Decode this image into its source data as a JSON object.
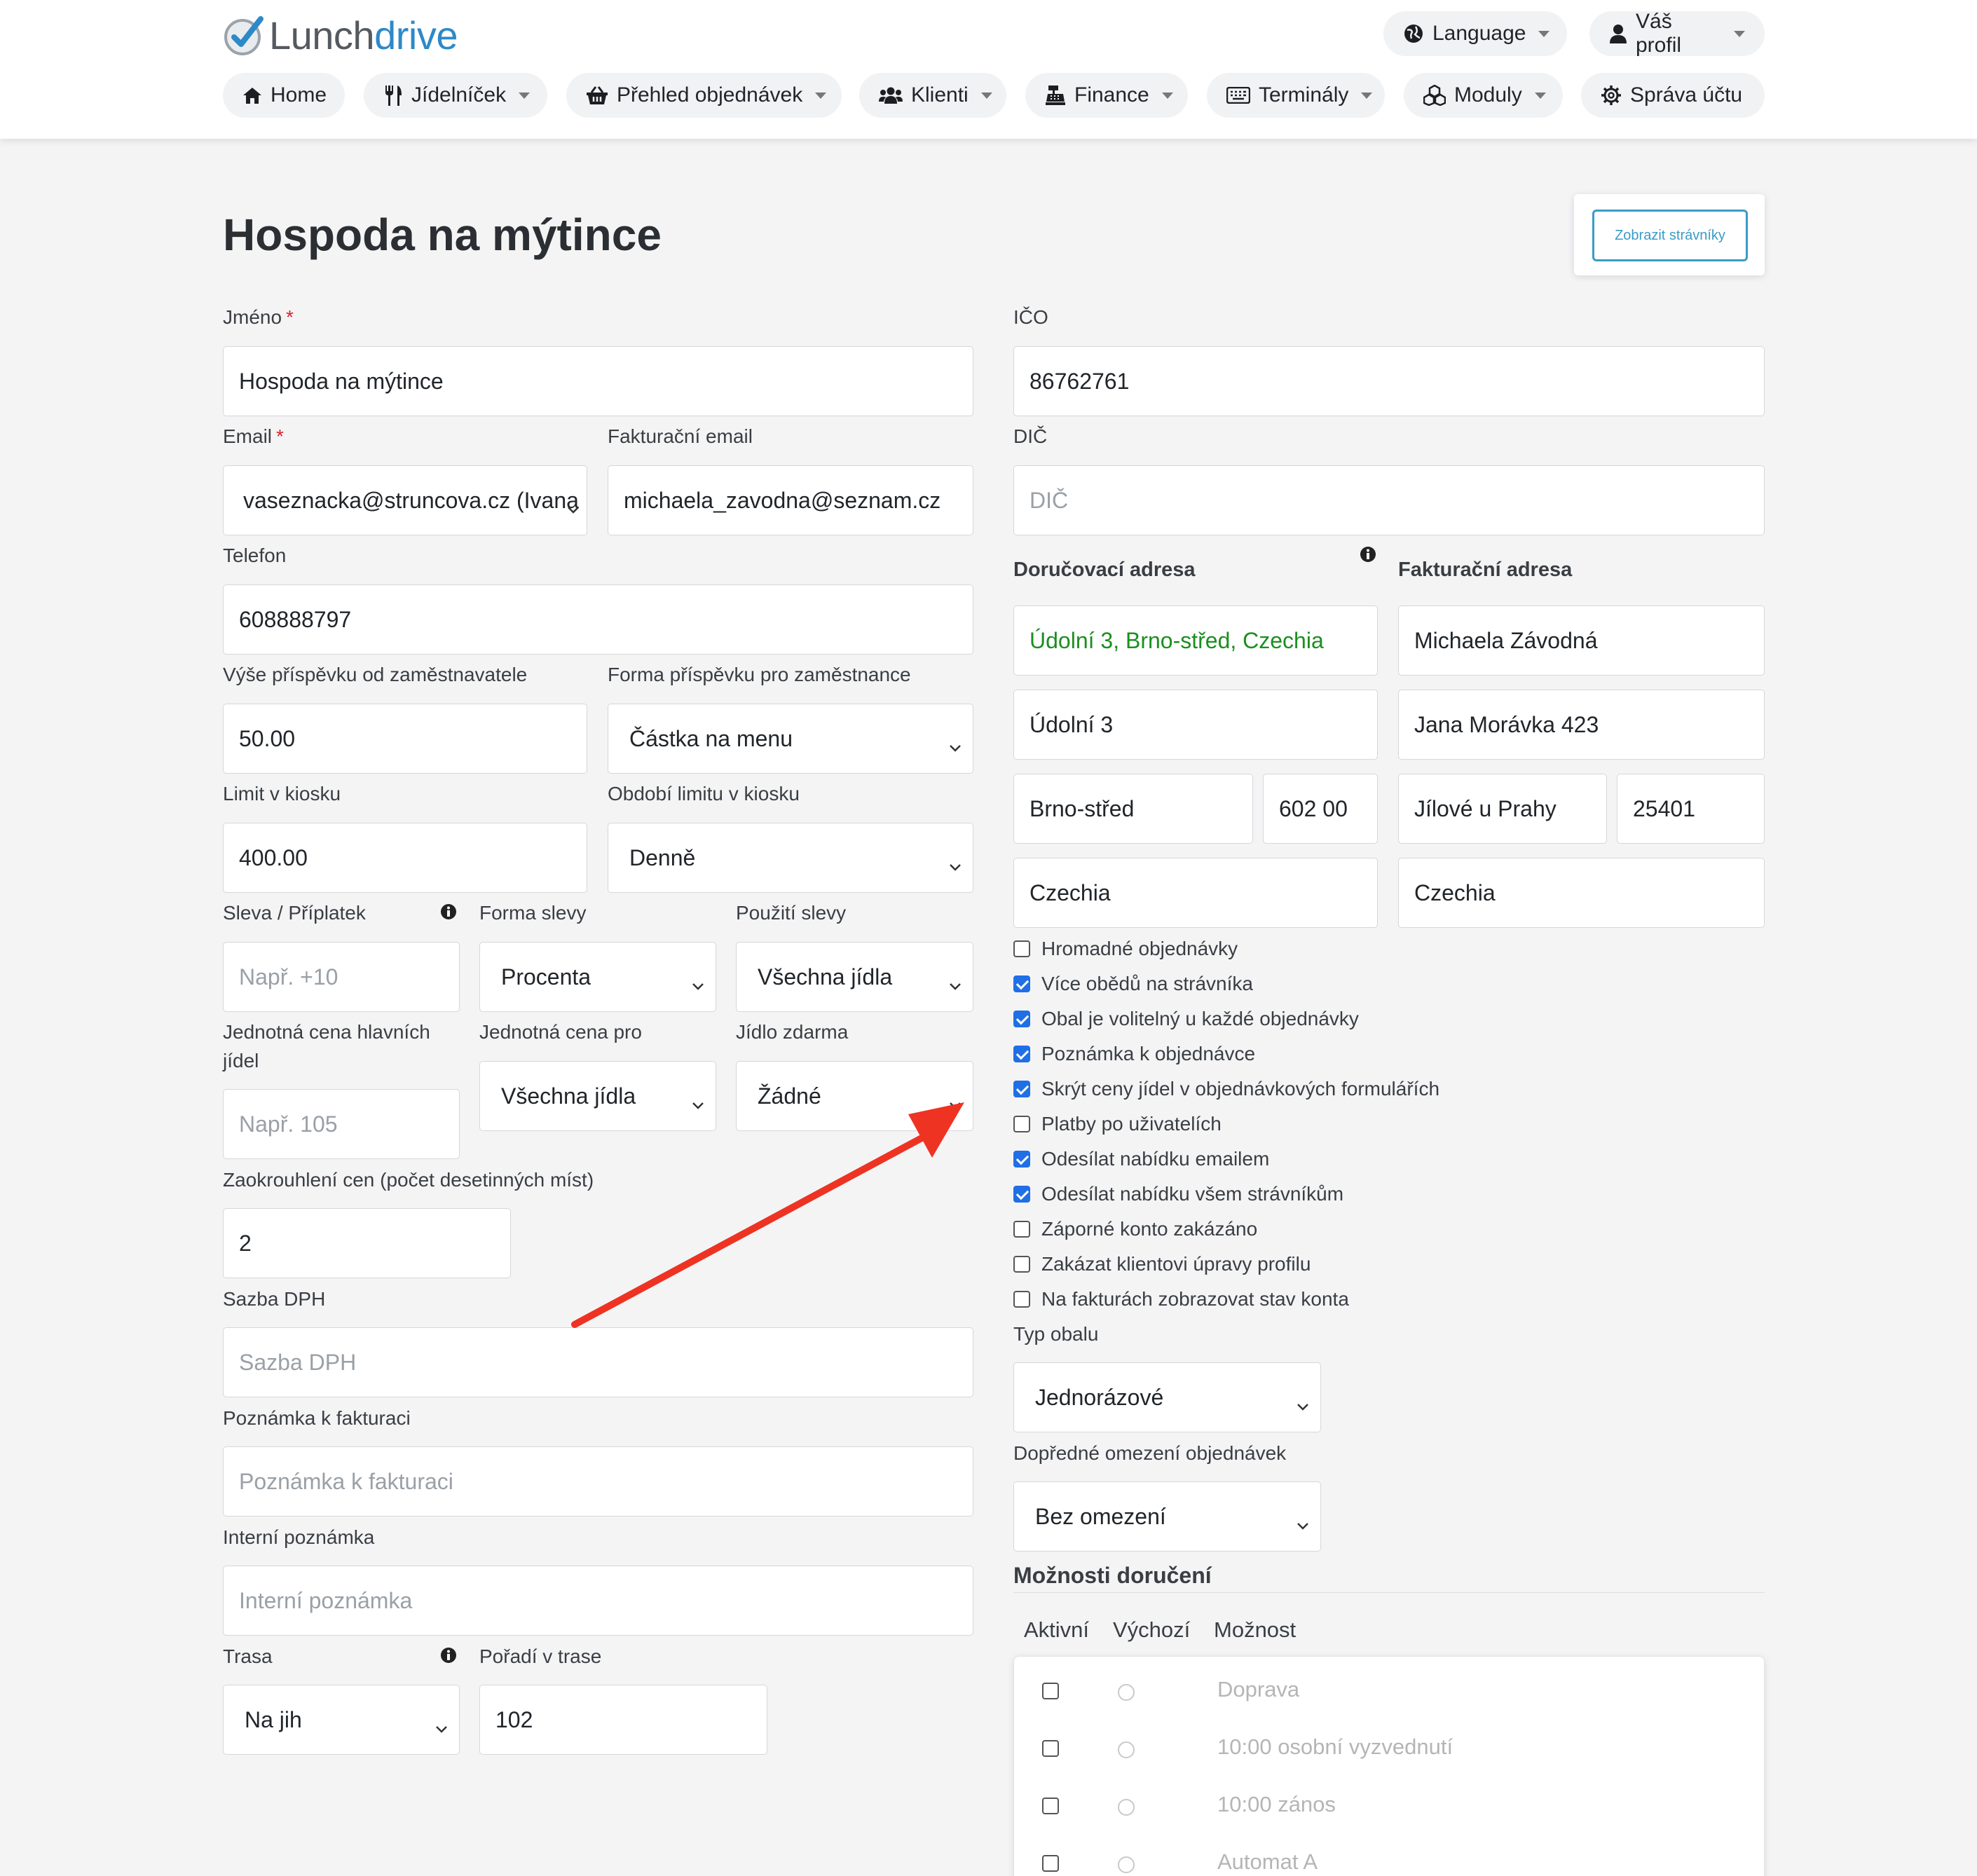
{
  "header": {
    "logo": {
      "part1": "Lunch",
      "part2": "drive",
      "icon": "checkmark-logo-icon"
    },
    "language_label": "Language",
    "profile_label": "Váš profil",
    "nav": [
      {
        "label": "Home",
        "icon": "home-icon"
      },
      {
        "label": "Jídelníček",
        "icon": "utensils-icon"
      },
      {
        "label": "Přehled objednávek",
        "icon": "basket-icon"
      },
      {
        "label": "Klienti",
        "icon": "users-icon"
      },
      {
        "label": "Finance",
        "icon": "cash-register-icon"
      },
      {
        "label": "Terminály",
        "icon": "keyboard-icon"
      },
      {
        "label": "Moduly",
        "icon": "cubes-icon"
      },
      {
        "label": "Správa účtu",
        "icon": "gear-icon"
      }
    ]
  },
  "page": {
    "title": "Hospoda na mýtince",
    "show_diners_button": "Zobrazit strávníky"
  },
  "form": {
    "name": {
      "label": "Jméno",
      "value": "Hospoda na mýtince"
    },
    "email": {
      "label": "Email",
      "value": "vaseznacka@struncova.cz (Ivana"
    },
    "billing_email": {
      "label": "Fakturační email",
      "value": "michaela_zavodna@seznam.cz"
    },
    "phone": {
      "label": "Telefon",
      "value": "608888797"
    },
    "employer_contribution": {
      "label": "Výše příspěvku od zaměstnavatele",
      "value": "50.00"
    },
    "contribution_form": {
      "label": "Forma příspěvku pro zaměstnance",
      "value": "Částka na menu"
    },
    "kiosk_limit": {
      "label": "Limit v kiosku",
      "value": "400.00"
    },
    "kiosk_limit_period": {
      "label": "Období limitu v kiosku",
      "value": "Denně"
    },
    "discount": {
      "label": "Sleva / Příplatek",
      "placeholder": "Např. +10"
    },
    "discount_form": {
      "label": "Forma slevy",
      "value": "Procenta"
    },
    "discount_usage": {
      "label": "Použití slevy",
      "value": "Všechna jídla"
    },
    "unit_price_main": {
      "label_line1": "Jednotná cena hlavních",
      "label_line2": "jídel",
      "placeholder": "Např. 105"
    },
    "unit_price_for": {
      "label": "Jednotná cena pro",
      "value": "Všechna jídla"
    },
    "free_meal": {
      "label": "Jídlo zdarma",
      "value": "Žádné"
    },
    "price_rounding": {
      "label": "Zaokrouhlení cen (počet desetinných míst)",
      "value": "2"
    },
    "vat_rate": {
      "label": "Sazba DPH",
      "placeholder": "Sazba DPH"
    },
    "invoice_note": {
      "label": "Poznámka k fakturaci",
      "placeholder": "Poznámka k fakturaci"
    },
    "internal_note": {
      "label": "Interní poznámka",
      "placeholder": "Interní poznámka"
    },
    "route": {
      "label": "Trasa",
      "value": "Na jih"
    },
    "route_order": {
      "label": "Pořadí v trase",
      "value": "102"
    },
    "ico": {
      "label": "IČO",
      "value": "86762761"
    },
    "dic": {
      "label": "DIČ",
      "placeholder": "DIČ"
    },
    "delivery_address": {
      "label": "Doručovací adresa",
      "full": "Údolní 3, Brno-střed, Czechia",
      "street": "Údolní 3",
      "city": "Brno-střed",
      "zip": "602 00",
      "country": "Czechia"
    },
    "billing_address": {
      "label": "Fakturační adresa",
      "name": "Michaela Závodná",
      "street": "Jana Morávka 423",
      "city": "Jílové u Prahy",
      "zip": "25401",
      "country": "Czechia"
    },
    "checkboxes": [
      {
        "label": "Hromadné objednávky",
        "checked": false
      },
      {
        "label": "Více obědů na strávníka",
        "checked": true
      },
      {
        "label": "Obal je volitelný u každé objednávky",
        "checked": true
      },
      {
        "label": "Poznámka k objednávce",
        "checked": true
      },
      {
        "label": "Skrýt ceny jídel v objednávkových formulářích",
        "checked": true
      },
      {
        "label": "Platby po uživatelích",
        "checked": false
      },
      {
        "label": "Odesílat nabídku emailem",
        "checked": true
      },
      {
        "label": "Odesílat nabídku všem strávníkům",
        "checked": true
      },
      {
        "label": "Záporné konto zakázáno",
        "checked": false
      },
      {
        "label": "Zakázat klientovi úpravy profilu",
        "checked": false
      },
      {
        "label": "Na fakturách zobrazovat stav konta",
        "checked": false
      }
    ],
    "package_type": {
      "label": "Typ obalu",
      "value": "Jednorázové"
    },
    "order_limit": {
      "label": "Dopředné omezení objednávek",
      "value": "Bez omezení"
    }
  },
  "delivery_options": {
    "title": "Možnosti doručení",
    "headers": {
      "active": "Aktivní",
      "default": "Výchozí",
      "option": "Možnost"
    },
    "rows": [
      {
        "label": "Doprava"
      },
      {
        "label": "10:00 osobní vyzvednutí"
      },
      {
        "label": "10:00 zános"
      },
      {
        "label": "Automat A"
      }
    ]
  },
  "colors": {
    "accent": "#2d89c8",
    "checkbox": "#1f6fe6",
    "annotation_arrow": "#ee3323",
    "required": "#d9262c",
    "address_green": "#1a8f1f"
  }
}
